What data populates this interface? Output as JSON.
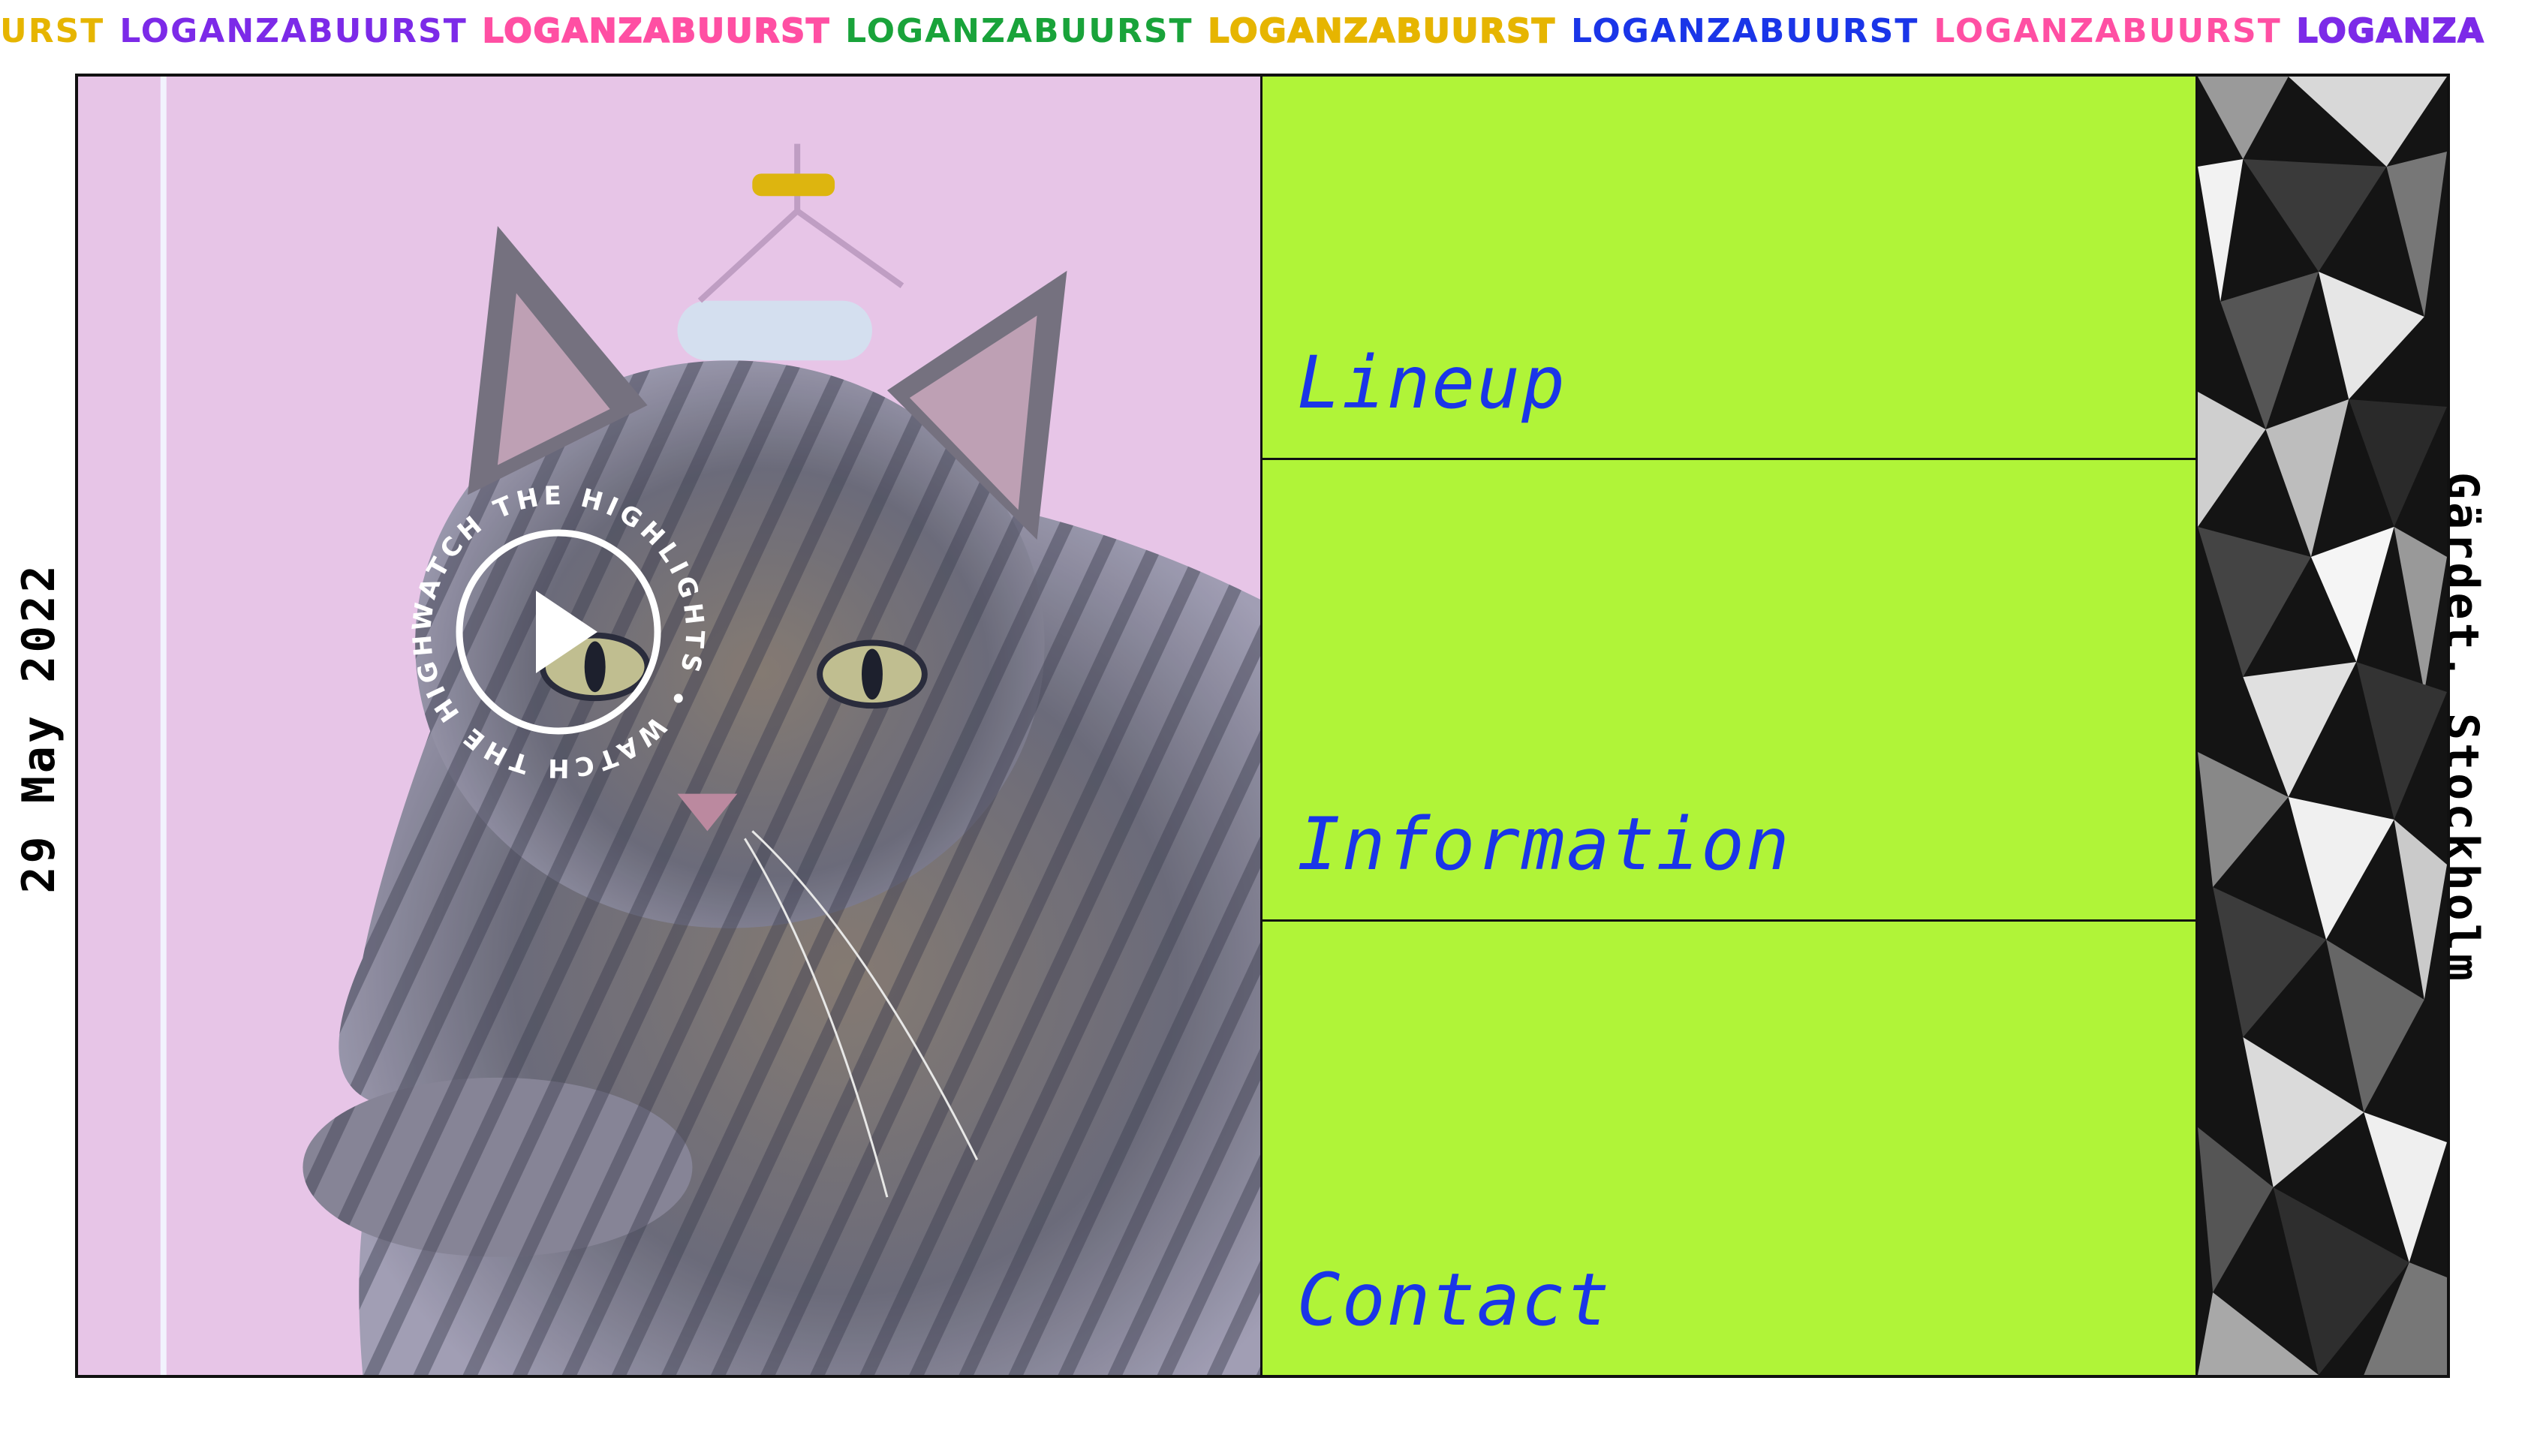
{
  "marquee": {
    "segments": [
      {
        "text": "URST",
        "color": "#e6b500",
        "outline": false
      },
      {
        "text": "LOGANZABUURST",
        "color": "#7c2ae8",
        "outline": false
      },
      {
        "text": "LOGANZABUURST",
        "color": "#ff4fa3",
        "outline": true
      },
      {
        "text": "LOGANZABUURST",
        "color": "#19a33a",
        "outline": false
      },
      {
        "text": "LOGANZABUURST",
        "color": "#e6b500",
        "outline": true
      },
      {
        "text": "LOGANZABUURST",
        "color": "#1a35e8",
        "outline": false
      },
      {
        "text": "LOGANZABUURST",
        "color": "#ff4fa3",
        "outline": false
      },
      {
        "text": "LOGANZA",
        "color": "#7c2ae8",
        "outline": true
      }
    ]
  },
  "event": {
    "date": "29 May 2022",
    "location": "Gärdet, Stockholm"
  },
  "hero": {
    "play_ring_text": "WATCH THE HIGHLIGHTS • WATCH THE HIGHLIGHTS •",
    "play_label": "Play video"
  },
  "nav": {
    "items": [
      {
        "label": "Lineup"
      },
      {
        "label": "Information"
      },
      {
        "label": "Contact"
      }
    ]
  },
  "colors": {
    "accent_green": "#b0f438",
    "link_blue": "#1a35e8",
    "hero_pink": "#f3c9e6"
  }
}
